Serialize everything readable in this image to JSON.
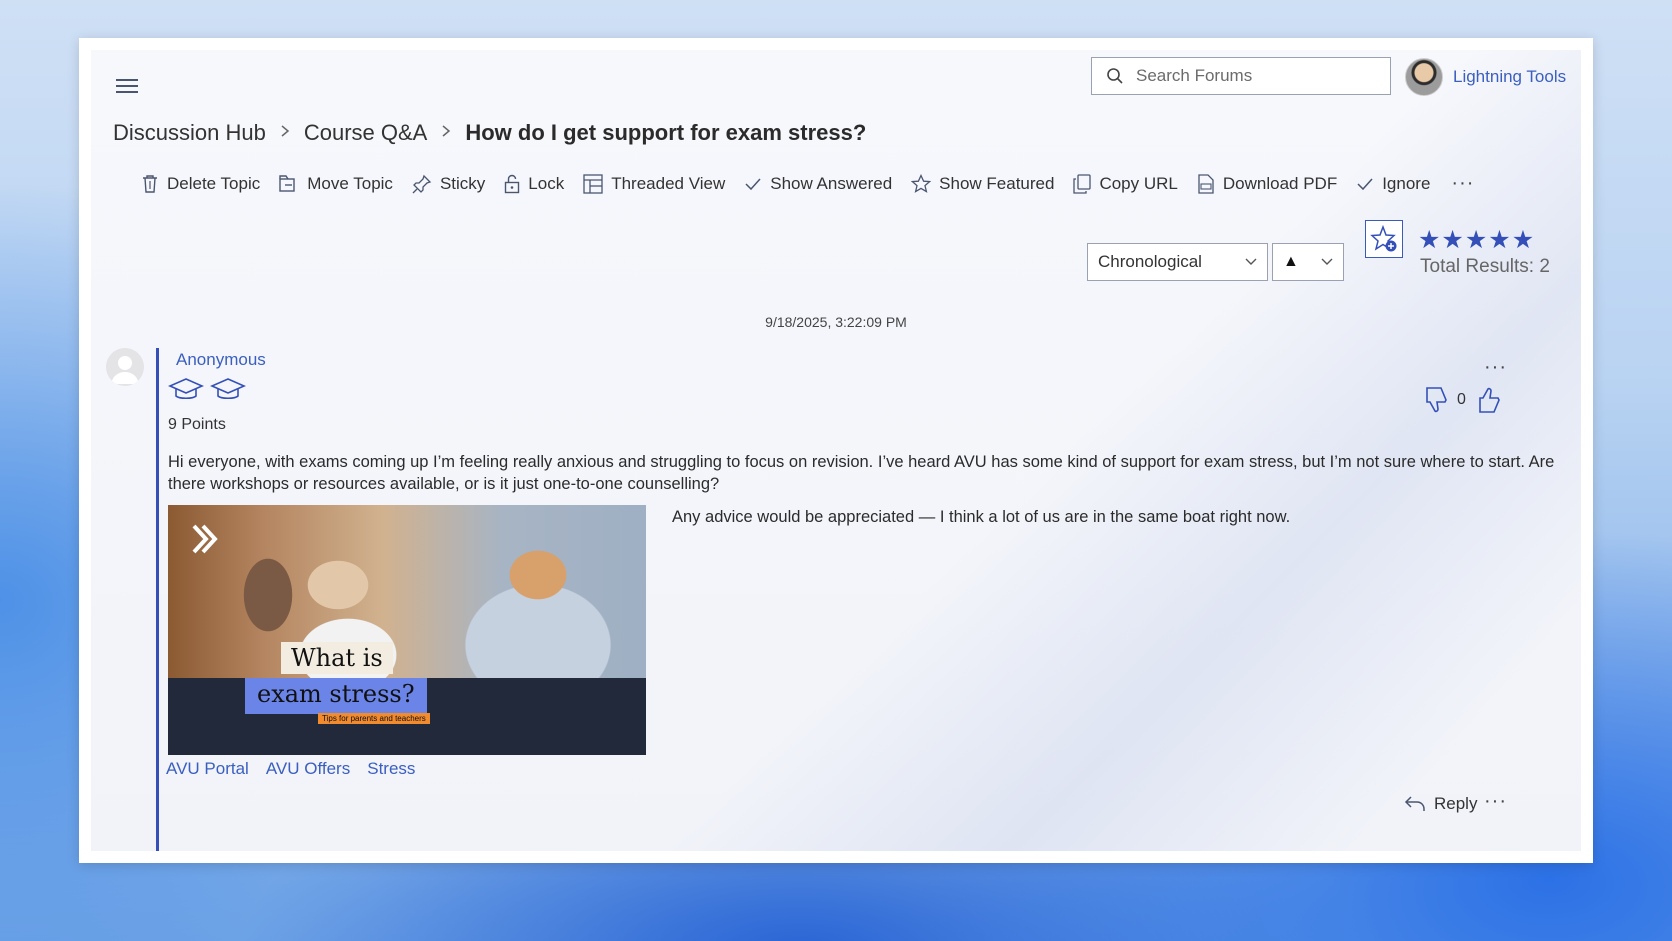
{
  "header": {
    "search_placeholder": "Search Forums",
    "user_name": "Lightning Tools"
  },
  "breadcrumb": {
    "items": [
      "Discussion Hub",
      "Course Q&A"
    ],
    "current": "How do I get support for exam stress?"
  },
  "toolbar": {
    "items": [
      {
        "label": "Delete Topic",
        "icon": "trash-icon"
      },
      {
        "label": "Move Topic",
        "icon": "move-icon"
      },
      {
        "label": "Sticky",
        "icon": "pin-icon"
      },
      {
        "label": "Lock",
        "icon": "lock-icon"
      },
      {
        "label": "Threaded View",
        "icon": "threaded-view-icon"
      },
      {
        "label": "Show Answered",
        "icon": "check-icon"
      },
      {
        "label": "Show Featured",
        "icon": "star-outline-icon"
      },
      {
        "label": "Copy URL",
        "icon": "copy-icon"
      },
      {
        "label": "Download PDF",
        "icon": "pdf-icon"
      },
      {
        "label": "Ignore",
        "icon": "check-icon"
      }
    ],
    "more_label": "···"
  },
  "sort": {
    "selected": "Chronological",
    "direction": "▲"
  },
  "rating": {
    "stars": 5,
    "total_results": "Total Results: 2"
  },
  "post": {
    "timestamp": "9/18/2025, 3:22:09 PM",
    "author": "Anonymous",
    "points": "9 Points",
    "vote_count": "0",
    "more_label": "···",
    "body_1": "Hi everyone, with exams coming up I’m feeling really anxious and struggling to focus on revision. I’ve heard AVU has some kind of support for exam stress, but I’m not sure where to start. Are there workshops or resources available, or is it just one-to-one counselling?",
    "body_2": "Any advice would be appreciated — I think a lot of us are in the same boat right now.",
    "image": {
      "title_line1": "What is",
      "title_line2": "exam stress?",
      "subtitle": "Tips for parents and teachers"
    },
    "tags": [
      "AVU Portal",
      "AVU Offers",
      "Stress"
    ],
    "reply_label": "Reply"
  },
  "colors": {
    "accent": "#3450b8",
    "link": "#3a5fbf"
  }
}
